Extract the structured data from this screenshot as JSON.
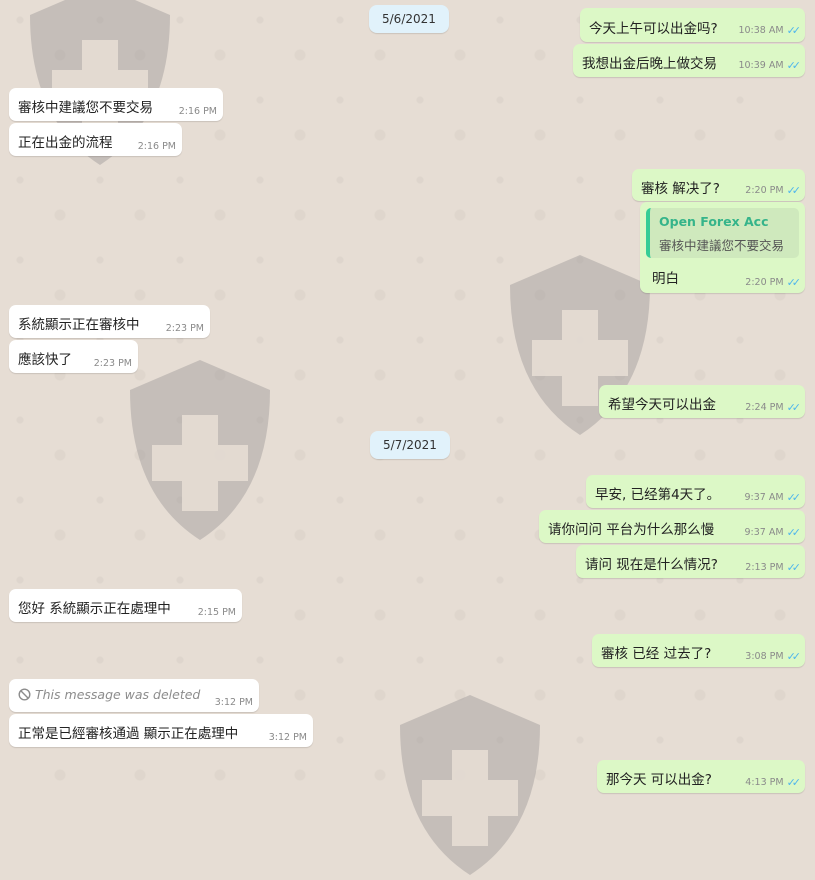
{
  "dates": [
    "5/6/2021",
    "5/7/2021"
  ],
  "messages": [
    {
      "text": "今天上午可以出金吗?",
      "time": "10:38 AM"
    },
    {
      "text": "我想出金后晚上做交易",
      "time": "10:39 AM"
    },
    {
      "text": "審核中建議您不要交易",
      "time": "2:16 PM"
    },
    {
      "text": "正在出金的流程",
      "time": "2:16 PM"
    },
    {
      "text": "審核 解决了?",
      "time": "2:20 PM"
    },
    {
      "quote_author": "Open Forex Acc",
      "quote_text": "審核中建議您不要交易",
      "text": "明白",
      "time": "2:20 PM"
    },
    {
      "text": "系統顯示正在審核中",
      "time": "2:23 PM"
    },
    {
      "text": "應該快了",
      "time": "2:23 PM"
    },
    {
      "text": "希望今天可以出金",
      "time": "2:24 PM"
    },
    {
      "text": "早安, 已经第4天了。",
      "time": "9:37 AM"
    },
    {
      "text": "请你问问 平台为什么那么慢",
      "time": "9:37 AM"
    },
    {
      "text": "请问 现在是什么情况?",
      "time": "2:13 PM"
    },
    {
      "text": "您好 系統顯示正在處理中",
      "time": "2:15 PM"
    },
    {
      "text": "審核 已经 过去了?",
      "time": "3:08 PM"
    },
    {
      "text": "This message was deleted",
      "time": "3:12 PM"
    },
    {
      "text": "正常是已經審核通過 顯示正在處理中",
      "time": "3:12 PM"
    },
    {
      "text": "那今天 可以出金?",
      "time": "4:13 PM"
    }
  ],
  "icons": {
    "read_receipt": "double-check-icon",
    "deleted": "prohibited-icon",
    "watermark": "shield-cross-icon"
  },
  "colors": {
    "outgoing": "#dcf8c6",
    "incoming": "#ffffff",
    "date_chip": "#e1f2fb",
    "read_tick": "#4fb6ec",
    "quote_author": "#35b48a"
  }
}
